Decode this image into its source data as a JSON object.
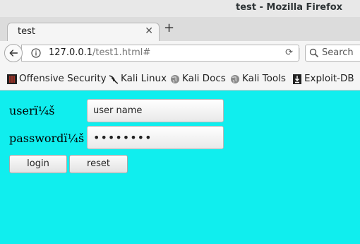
{
  "window": {
    "title": "test - Mozilla Firefox"
  },
  "tab": {
    "label": "test"
  },
  "navbar": {
    "url_host": "127.0.0.1",
    "url_path": "/test1.html#",
    "search_placeholder": "Search"
  },
  "bookmarks": [
    {
      "label": "Offensive Security",
      "icon": "offsec-icon"
    },
    {
      "label": "Kali Linux",
      "icon": "kali-dragon-icon"
    },
    {
      "label": "Kali Docs",
      "icon": "globe-icon"
    },
    {
      "label": "Kali Tools",
      "icon": "globe-icon"
    },
    {
      "label": "Exploit-DB",
      "icon": "exploit-db-icon"
    }
  ],
  "form": {
    "user_label": "userï¼š",
    "user_value": "user name",
    "password_label": "passwordï¼š",
    "password_value": "••••••••",
    "login_label": "login",
    "reset_label": "reset"
  },
  "colors": {
    "page_background": "#10eeee"
  }
}
